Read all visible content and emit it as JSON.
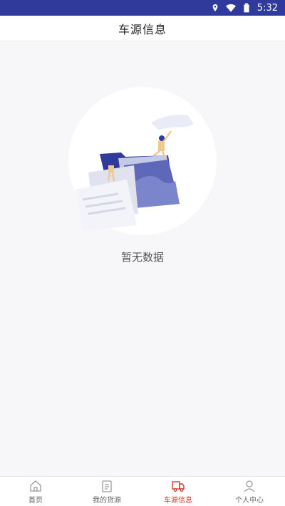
{
  "status_bar": {
    "time": "5:32",
    "icons": [
      "location-icon",
      "wifi-icon",
      "battery-icon"
    ]
  },
  "header": {
    "title": "车源信息"
  },
  "empty_state": {
    "message": "暂无数据",
    "illustration": "empty-folder-illustration"
  },
  "tabbar": {
    "active_color": "#d23a2d",
    "items": [
      {
        "label": "首页",
        "icon": "home-icon",
        "active": false
      },
      {
        "label": "我的货源",
        "icon": "clipboard-icon",
        "active": false
      },
      {
        "label": "车源信息",
        "icon": "truck-icon",
        "active": true
      },
      {
        "label": "个人中心",
        "icon": "person-icon",
        "active": false
      }
    ]
  }
}
